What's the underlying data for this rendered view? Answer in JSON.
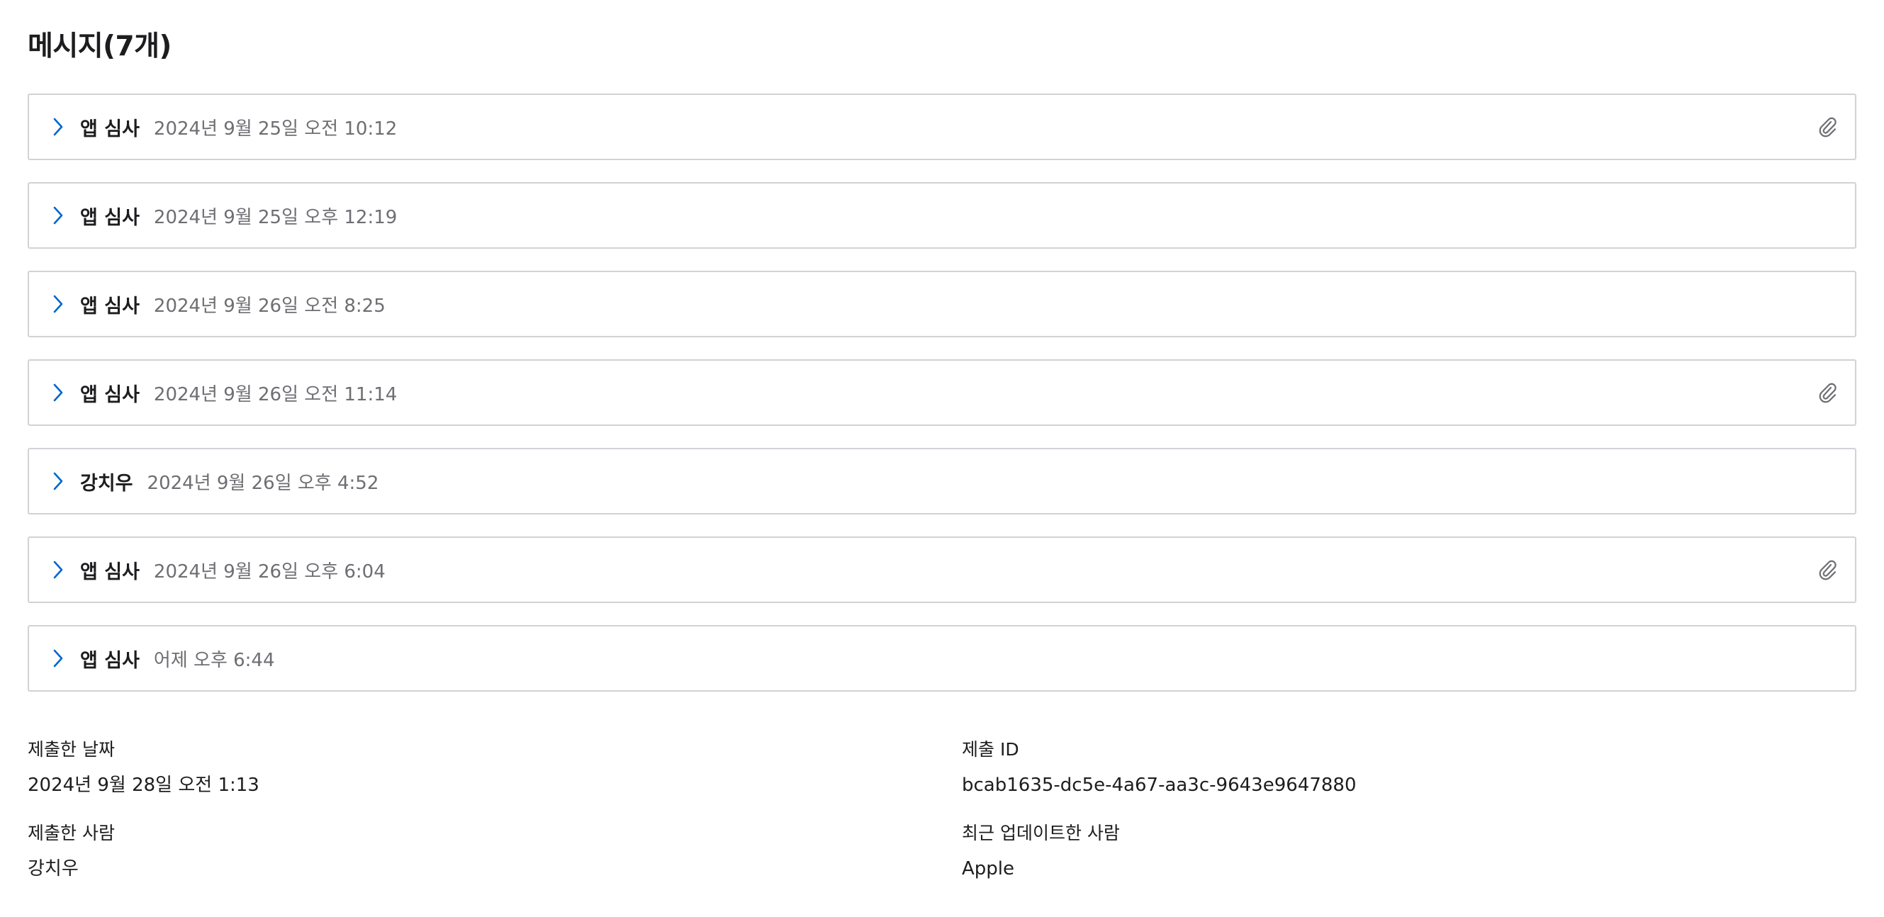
{
  "title": "메시지(7개)",
  "messages": [
    {
      "sender": "앱 심사",
      "date": "2024년 9월 25일 오전 10:12",
      "attachment": true
    },
    {
      "sender": "앱 심사",
      "date": "2024년 9월 25일 오후 12:19",
      "attachment": false
    },
    {
      "sender": "앱 심사",
      "date": "2024년 9월 26일 오전 8:25",
      "attachment": false
    },
    {
      "sender": "앱 심사",
      "date": "2024년 9월 26일 오전 11:14",
      "attachment": true
    },
    {
      "sender": "강치우",
      "date": "2024년 9월 26일 오후 4:52",
      "attachment": false
    },
    {
      "sender": "앱 심사",
      "date": "2024년 9월 26일 오후 6:04",
      "attachment": true
    },
    {
      "sender": "앱 심사",
      "date": "어제 오후 6:44",
      "attachment": false
    }
  ],
  "meta": {
    "submitted_date_label": "제출한 날짜",
    "submitted_date": "2024년 9월 28일 오전 1:13",
    "submission_id_label": "제출 ID",
    "submission_id": "bcab1635-dc5e-4a67-aa3c-9643e9647880",
    "submitted_by_label": "제출한 사람",
    "submitted_by": "강치우",
    "last_updated_by_label": "최근 업데이트한 사람",
    "last_updated_by": "Apple"
  },
  "icons": {
    "expand": "chevron-right-icon",
    "attachment": "paperclip-icon"
  },
  "colors": {
    "accent": "#0066cc",
    "border": "#d2d2d7",
    "secondary_text": "#6e6e73",
    "icon_gray": "#6e6e73"
  }
}
